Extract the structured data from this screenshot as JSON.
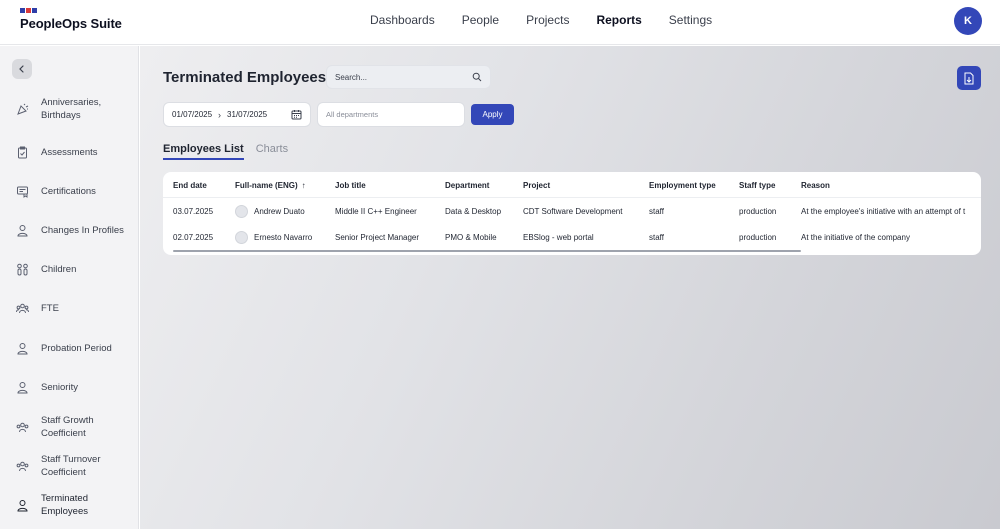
{
  "app": {
    "brand_name": "PeopleOps Suite",
    "user_initial": "K"
  },
  "nav": {
    "items": [
      {
        "label": "Dashboards"
      },
      {
        "label": "People"
      },
      {
        "label": "Projects"
      },
      {
        "label": "Reports",
        "active": true
      },
      {
        "label": "Settings"
      }
    ]
  },
  "sidebar": {
    "items": [
      {
        "label": "Anniversaries, Birthdays",
        "icon": "party-icon"
      },
      {
        "label": "Assessments",
        "icon": "clipboard-check-icon"
      },
      {
        "label": "Certifications",
        "icon": "certificate-icon"
      },
      {
        "label": "Changes In Profiles",
        "icon": "user-icon"
      },
      {
        "label": "Children",
        "icon": "children-icon"
      },
      {
        "label": "FTE",
        "icon": "team-icon"
      },
      {
        "label": "Probation Period",
        "icon": "user-icon"
      },
      {
        "label": "Seniority",
        "icon": "user-icon"
      },
      {
        "label": "Staff Growth Coefficient",
        "icon": "team-icon"
      },
      {
        "label": "Staff Turnover Coefficient",
        "icon": "team-icon"
      },
      {
        "label": "Terminated Employees",
        "icon": "user-icon",
        "active": true
      }
    ]
  },
  "page": {
    "title": "Terminated Employees",
    "search_placeholder": "Search..."
  },
  "filters": {
    "date_from": "01/07/2025",
    "date_to": "31/07/2025",
    "department_placeholder": "All departments",
    "apply_label": "Apply"
  },
  "tabs": [
    {
      "label": "Employees List",
      "active": true
    },
    {
      "label": "Charts"
    }
  ],
  "table": {
    "columns": [
      "End date",
      "Full-name (ENG)",
      "Job title",
      "Department",
      "Project",
      "Employment type",
      "Staff type",
      "Reason"
    ],
    "sort_indicator": "↑",
    "rows": [
      [
        "03.07.2025",
        "Andrew Duato",
        "Middle II C++ Engineer",
        "Data & Desktop",
        "CDT Software Development",
        "staff",
        "production",
        "At the employee's initiative with an attempt of t"
      ],
      [
        "02.07.2025",
        "Ernesto Navarro",
        "Senior Project Manager",
        "PMO & Mobile",
        "EBSlog - web portal",
        "staff",
        "production",
        "At the initiative of the company"
      ]
    ]
  },
  "colors": {
    "accent": "#3347b8",
    "flag_blue": "#2f3ea8",
    "flag_red": "#d93a3a"
  }
}
